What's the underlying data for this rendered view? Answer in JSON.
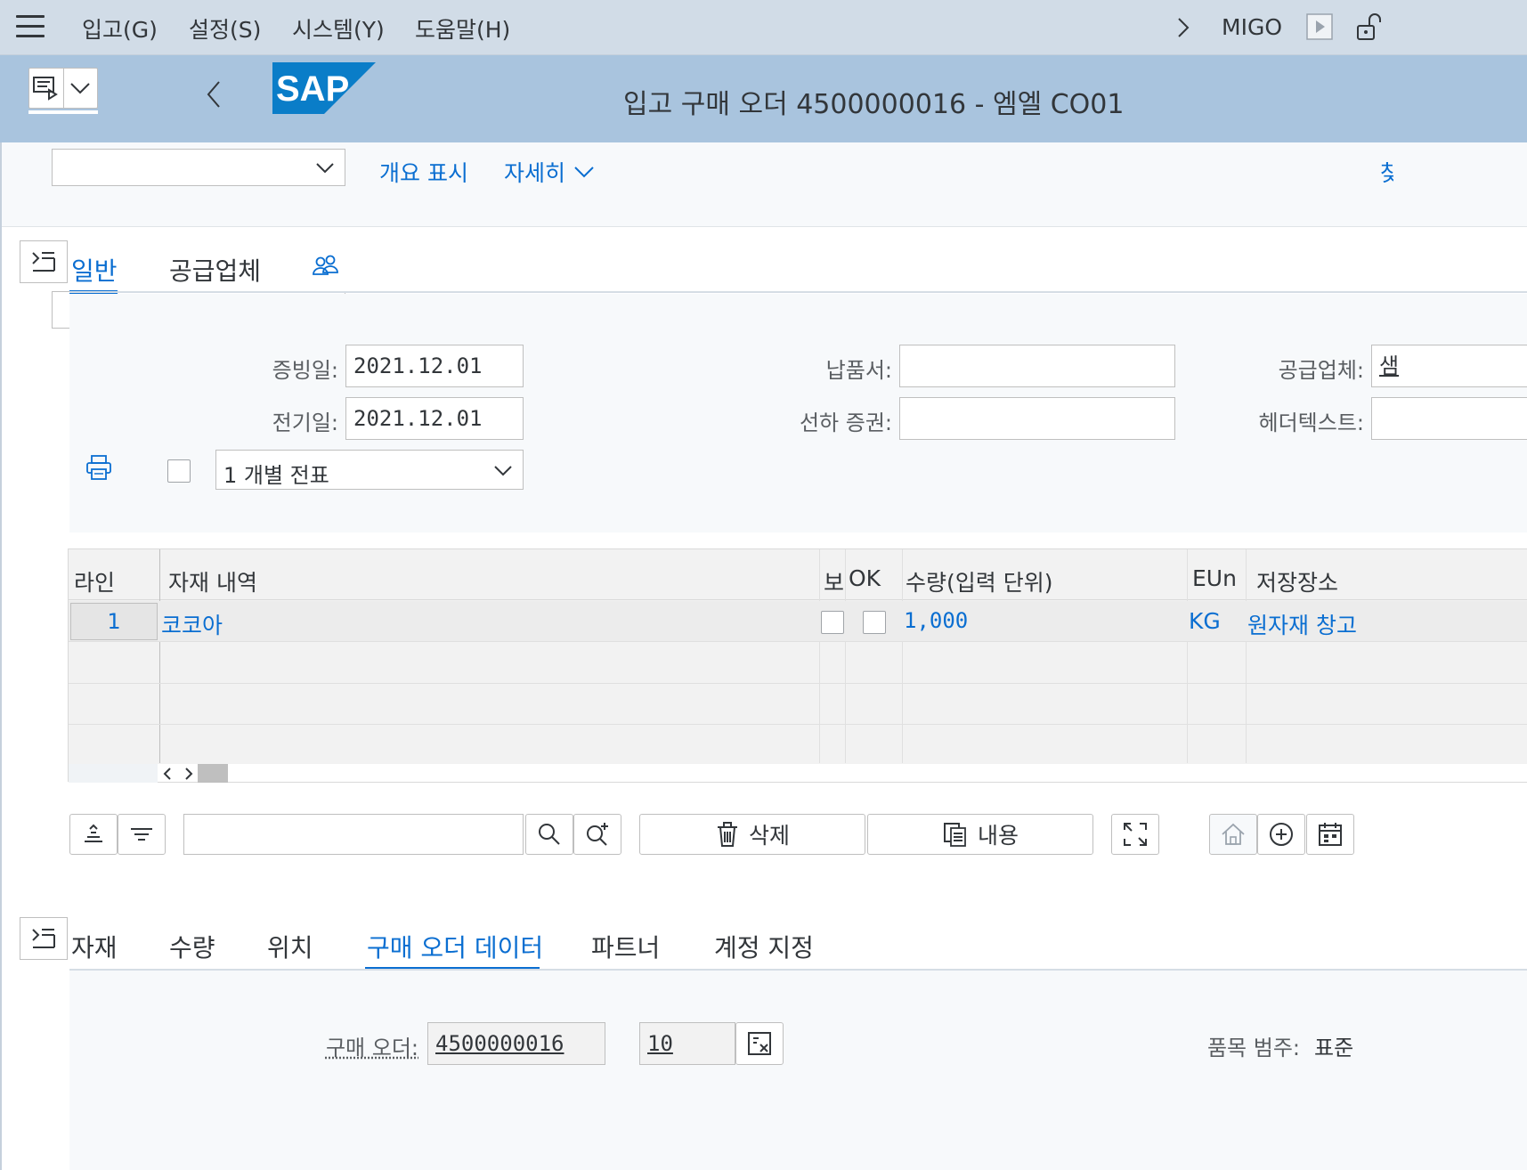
{
  "menu": {
    "items": [
      "입고(G)",
      "설정(S)",
      "시스템(Y)",
      "도움말(H)"
    ],
    "tcode": "MIGO"
  },
  "header": {
    "title": "입고 구매 오더 4500000016 - 엠엘 CO01",
    "logo_text": "SAP"
  },
  "toolbar": {
    "dropdown_value": "",
    "overview_label": "개요 표시",
    "details_label": "자세히",
    "cut_label": "찾"
  },
  "header_tabs": {
    "items": [
      "일반",
      "공급업체"
    ],
    "active": "일반"
  },
  "form": {
    "doc_date_label": "증빙일:",
    "doc_date": "2021.12.01",
    "post_date_label": "전기일:",
    "post_date": "2021.12.01",
    "delivery_note_label": "납품서:",
    "delivery_note": "",
    "bill_of_lading_label": "선하 증권:",
    "bill_of_lading": "",
    "vendor_label": "공급업체:",
    "vendor_value": "샘",
    "header_text_label": "헤더텍스트:",
    "header_text": "",
    "slip_type": "1 개별 전표"
  },
  "table": {
    "columns": [
      "라인",
      "자재 내역",
      "보",
      "OK",
      "수량(입력 단위)",
      "EUn",
      "저장장소"
    ],
    "rows": [
      {
        "line": "1",
        "material": "코코아",
        "qty": "1,000",
        "unit": "KG",
        "storage": "원자재 창고"
      }
    ]
  },
  "actions": {
    "delete_label": "삭제",
    "contents_label": "내용",
    "search_value": ""
  },
  "detail_tabs": {
    "items": [
      "자재",
      "수량",
      "위치",
      "구매 오더 데이터",
      "파트너",
      "계정 지정"
    ],
    "active": "구매 오더 데이터"
  },
  "detail": {
    "po_label": "구매 오더:",
    "po_number": "4500000016",
    "po_item": "10",
    "item_category_label": "품목 범주:",
    "item_category": "표준"
  },
  "colors": {
    "menubar": "#d1dce7",
    "titlebar": "#a9c4de",
    "accent": "#0a6ed1",
    "sap_logo": "#0a7dc8"
  }
}
